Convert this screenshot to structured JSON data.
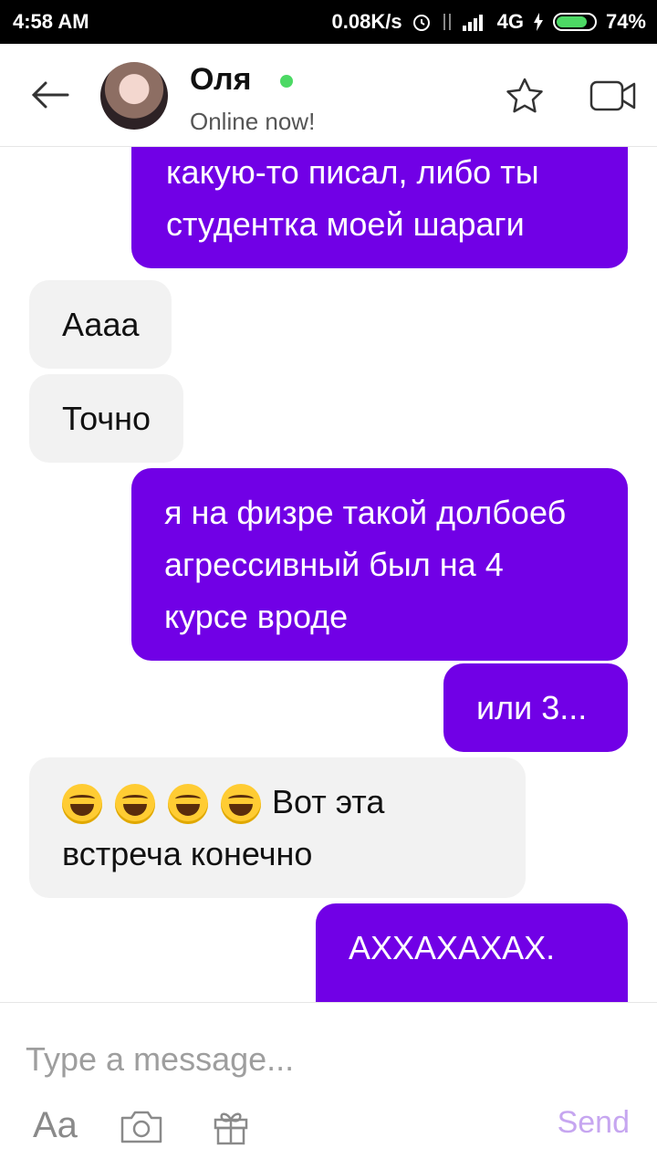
{
  "status_bar": {
    "time": "4:58 AM",
    "net_speed": "0.08K/s",
    "network": "4G",
    "battery": "74%",
    "battery_level": 0.74
  },
  "header": {
    "contact_name": "Оля",
    "status": "Online now!",
    "online_color": "#4cd964"
  },
  "messages": [
    {
      "side": "out",
      "text": "какую-то писал, либо ты студентка моей шараги"
    },
    {
      "side": "in",
      "text": "Аааа"
    },
    {
      "side": "in",
      "text": "Точно"
    },
    {
      "side": "out",
      "text": "я на физре такой долбоеб агрессивный был на 4 курсе вроде"
    },
    {
      "side": "out",
      "text": "или 3..."
    },
    {
      "side": "in",
      "emoji": [
        "grin-tears-emoji",
        "grin-tears-emoji",
        "grin-tears-emoji",
        "grin-tears-emoji"
      ],
      "text": "Вот эта встреча конечно"
    },
    {
      "side": "out",
      "text": "АХХАХАХАХ."
    }
  ],
  "composer": {
    "placeholder": "Type a message...",
    "aa_label": "Aa",
    "send_label": "Send"
  },
  "colors": {
    "outgoing_bubble": "#7100e6",
    "incoming_bubble": "#f2f2f2",
    "send_disabled": "#c6a6f0"
  }
}
